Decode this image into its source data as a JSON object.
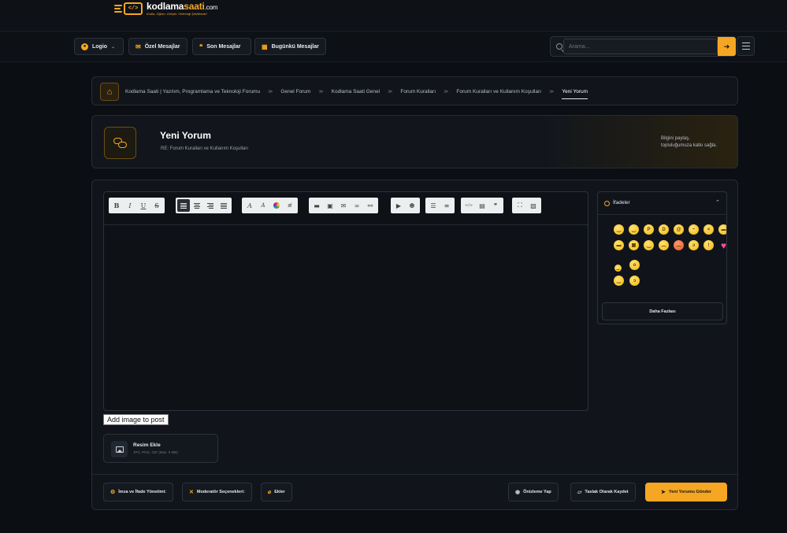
{
  "logo": {
    "mark": "</>",
    "name_part1": "kodlama",
    "name_part2": "saati",
    "domain": ".com",
    "tagline": "Kodla, Öğren, Geliştir. Geleceği Şekillendir!"
  },
  "nav": {
    "user_label": "Logio",
    "private_messages": "Özel Mesajlar",
    "latest_posts": "Son Mesajlar",
    "today_posts": "Bugünkü Mesajlar"
  },
  "search": {
    "placeholder": "Arama..."
  },
  "breadcrumb": {
    "items": [
      "Kodlama Saati | Yazılım, Programlama ve Teknoloji Forumu",
      "Genel Forum",
      "Kodlama Saati Genel",
      "Forum Kuralları",
      "Forum Kuralları ve Kullanım Koşulları"
    ],
    "current": "Yeni Yorum"
  },
  "hero": {
    "title": "Yeni Yorum",
    "subtitle": "RE: Forum Kuralları ve Kullanım Koşulları",
    "side_line1": "Bilgini paylaş,",
    "side_line2": "topluluğumuza katkı sağla."
  },
  "toolbar": {
    "bold": "B",
    "italic": "I",
    "underline": "U",
    "strike": "S",
    "font": "A",
    "size": "A",
    "code": "</>"
  },
  "attachments": {
    "tooltip": "Add image to post",
    "title": "Resim Ekle",
    "hint": "JPG, PNG, GIF (Max. 5 MB)"
  },
  "emoji_panel": {
    "title": "İfadeler",
    "more_button": "Daha Fazlası"
  },
  "footer": {
    "signature_options": "İmza ve İfade Yönetimi:",
    "moderator_options": "Moderatör Seçenekleri:",
    "attachments": "Ekler",
    "preview": "Önizleme Yap",
    "save_draft": "Taslak Olarak Kaydet",
    "submit": "Yeni Yorumu Gönder"
  },
  "colors": {
    "accent": "#f5a623",
    "background": "#0b0e13",
    "panel": "#11151b",
    "border": "#262c35"
  }
}
